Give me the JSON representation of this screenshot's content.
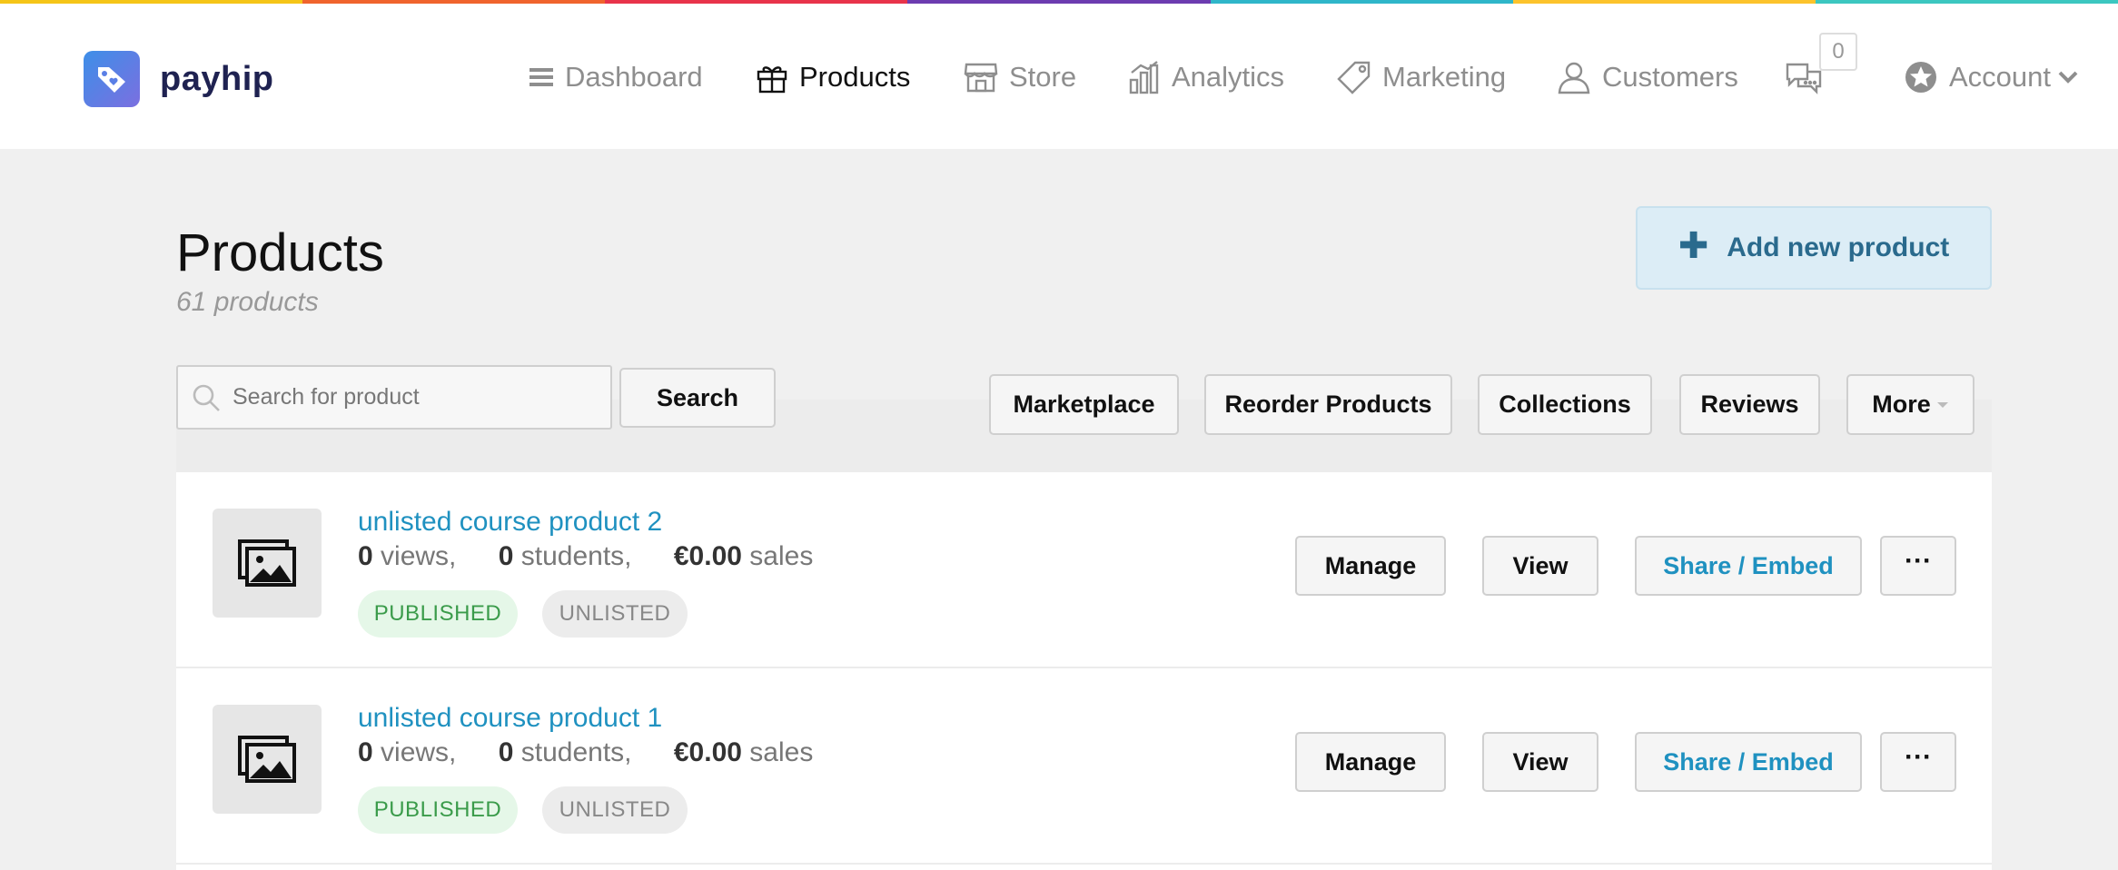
{
  "app": {
    "brand": "payhip"
  },
  "rainbow_colors": [
    "#f5c518",
    "#f0642d",
    "#e8334a",
    "#6c3cb0",
    "#2fb6c9",
    "#fcc32c",
    "#3cc7c0"
  ],
  "nav": {
    "items": [
      {
        "label": "Dashboard",
        "icon": "menu-icon"
      },
      {
        "label": "Products",
        "icon": "gift-icon",
        "active": true
      },
      {
        "label": "Store",
        "icon": "store-icon"
      },
      {
        "label": "Analytics",
        "icon": "bar-chart-icon"
      },
      {
        "label": "Marketing",
        "icon": "tag-icon"
      },
      {
        "label": "Customers",
        "icon": "user-icon"
      }
    ],
    "messages_count": "0",
    "account_label": "Account"
  },
  "page": {
    "title": "Products",
    "count": "61 products",
    "add_button": "Add new product"
  },
  "search": {
    "placeholder": "Search for product",
    "button": "Search"
  },
  "toolbar": {
    "marketplace": "Marketplace",
    "reorder": "Reorder Products",
    "collections": "Collections",
    "reviews": "Reviews",
    "more": "More"
  },
  "products": [
    {
      "title": "unlisted course product 2",
      "views": "0",
      "views_label": "views,",
      "students": "0",
      "students_label": "students,",
      "sales": "€0.00",
      "sales_label": "sales",
      "status": "PUBLISHED",
      "visibility": "UNLISTED",
      "manage": "Manage",
      "view": "View",
      "share": "Share / Embed",
      "more": "···"
    },
    {
      "title": "unlisted course product 1",
      "views": "0",
      "views_label": "views,",
      "students": "0",
      "students_label": "students,",
      "sales": "€0.00",
      "sales_label": "sales",
      "status": "PUBLISHED",
      "visibility": "UNLISTED",
      "manage": "Manage",
      "view": "View",
      "share": "Share / Embed",
      "more": "···"
    }
  ]
}
